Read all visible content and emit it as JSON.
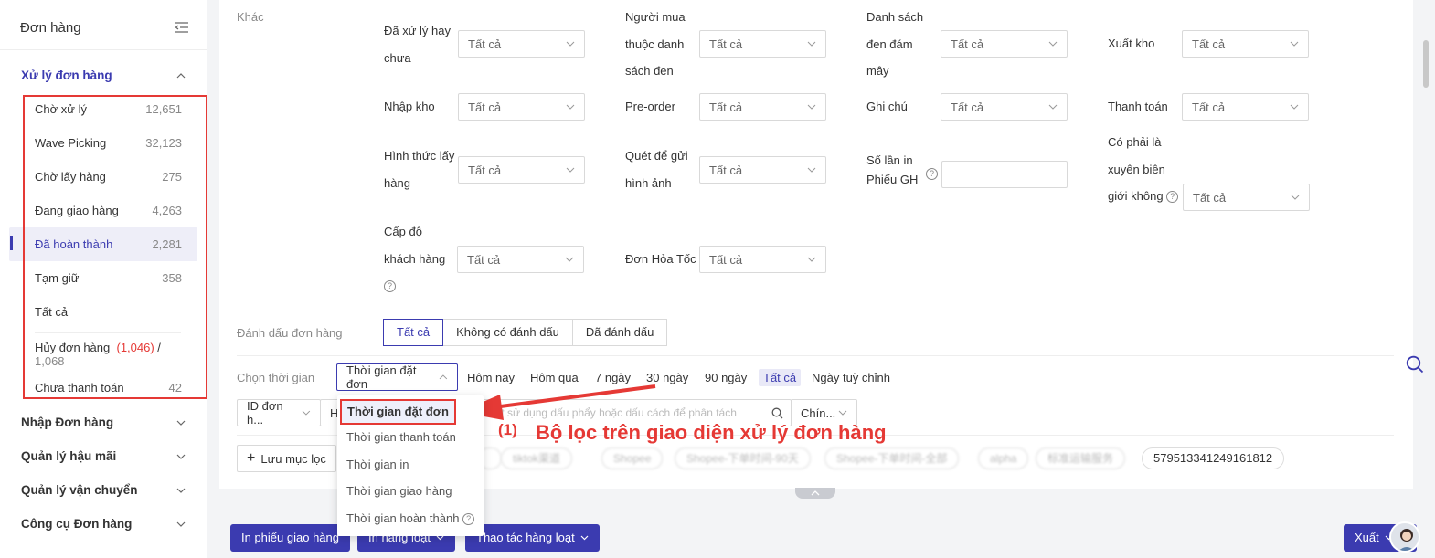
{
  "sidebar": {
    "title": "Đơn hàng",
    "group_active": "Xử lý đơn hàng",
    "items": [
      {
        "label": "Chờ xử lý",
        "count": "12,651"
      },
      {
        "label": "Wave Picking",
        "count": "32,123"
      },
      {
        "label": "Chờ lấy hàng",
        "count": "275"
      },
      {
        "label": "Đang giao hàng",
        "count": "4,263"
      },
      {
        "label": "Đã hoàn thành",
        "count": "2,281"
      },
      {
        "label": "Tạm giữ",
        "count": "358"
      },
      {
        "label": "Tất cả",
        "count": ""
      }
    ],
    "cancel": {
      "label": "Hủy đơn hàng",
      "red": "(1,046)",
      "sep": " / ",
      "total": "1,068"
    },
    "unpaid": {
      "label": "Chưa thanh toán",
      "count": "42"
    },
    "groups": [
      "Nhập Đơn hàng",
      "Quản lý hậu mãi",
      "Quản lý vận chuyển",
      "Công cụ Đơn hàng"
    ]
  },
  "filters": {
    "section": "Khác",
    "all": "Tất cả",
    "labels": {
      "processed": [
        "Đã xử lý hay",
        "chưa"
      ],
      "blacklist": [
        "Người mua",
        "thuộc danh",
        "sách đen"
      ],
      "cloud": [
        "Danh sách",
        "đen đám",
        "mây"
      ],
      "export": "Xuất kho",
      "import": "Nhập kho",
      "preorder": "Pre-order",
      "note": "Ghi chú",
      "payment": "Thanh toán",
      "pickup": [
        "Hình thức lấy",
        "hàng"
      ],
      "scan": [
        "Quét để gửi",
        "hình ảnh"
      ],
      "printcount": [
        "Số lần in",
        "Phiếu GH"
      ],
      "crossborder": [
        "Có phải là",
        "xuyên biên",
        "giới không"
      ],
      "level": [
        "Cấp độ",
        "khách hàng"
      ],
      "express": "Đơn Hỏa Tốc"
    },
    "mark_label": "Đánh dấu đơn hàng",
    "mark_options": [
      "Tất cả",
      "Không có đánh dấu",
      "Đã đánh dấu"
    ],
    "time_label": "Chọn thời gian",
    "time_select": "Thời gian đặt đơn",
    "time_options": [
      "Hôm nay",
      "Hôm qua",
      "7 ngày",
      "30 ngày",
      "90 ngày",
      "Tất cả",
      "Ngày tuỳ chỉnh"
    ],
    "id_select": "ID đơn h...",
    "h_partial": "H",
    "search_placeholder": "oặt sử dụng dấu phẩy hoặc dấu cách để phân tách",
    "chin_select": "Chín...",
    "save_filter": "Lưu mục lọc",
    "tags": [
      "",
      "tiktok渠道",
      "Shopee",
      "Shopee-下单时间-90天",
      "Shopee-下单时间-全部",
      "alpha",
      "标准运输服务"
    ],
    "tag_clear": "579513341249161812"
  },
  "dropdown": {
    "items": [
      "Thời gian đặt đơn",
      "Thời gian thanh toán",
      "Thời gian in",
      "Thời gian giao hàng",
      "Thời gian hoàn thành"
    ]
  },
  "annotation": {
    "num": "(1)",
    "text": "Bộ lọc trên giao diện xử lý đơn hàng"
  },
  "actions": {
    "print_delivery": "In phiếu giao hàng",
    "print_bulk": "In hàng loạt",
    "bulk_ops": "Thao tác hàng loạt",
    "export": "Xuất"
  },
  "colors": {
    "accent": "#3b3bb0",
    "annotation": "#e53935"
  }
}
